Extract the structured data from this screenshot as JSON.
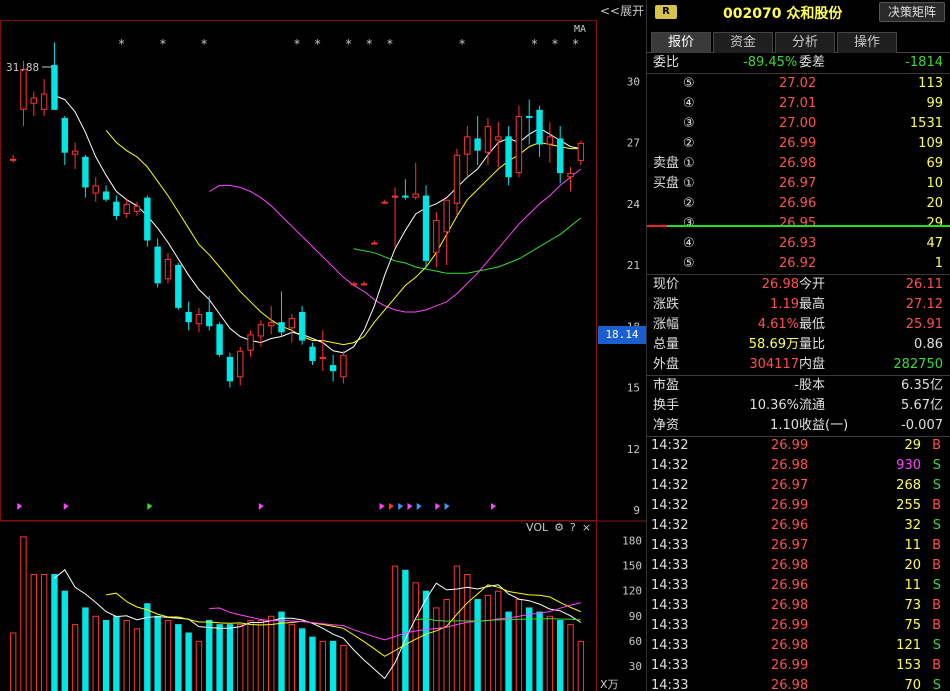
{
  "toolbar": {
    "collapse_label": "<<展开",
    "ma_label": "MA"
  },
  "main_chart": {
    "price_levels": [
      "30",
      "27",
      "24",
      "21",
      "18",
      "15",
      "12",
      "9"
    ],
    "price_level_values": [
      30,
      27,
      24,
      21,
      18,
      15,
      12,
      9
    ],
    "high_annotation": "31.88",
    "current_price_tag": "18.14",
    "star_markers_text": "*",
    "colors": {
      "up": "#ff3232",
      "down": "#00e5e5",
      "ma5": "#ffffff",
      "ma10": "#ffff00",
      "ma20": "#ff44ff",
      "ma60": "#33dd33",
      "price_tag_bg": "#1a5fd0"
    }
  },
  "volume_chart": {
    "label": "VOL",
    "gear_icon": "⚙",
    "help_icon": "?",
    "close_icon": "×",
    "levels": [
      "180",
      "150",
      "120",
      "90",
      "60",
      "30"
    ],
    "level_values": [
      180,
      150,
      120,
      90,
      60,
      30
    ],
    "unit": "X万"
  },
  "chart_data": {
    "type": "candlestick",
    "ylim": [
      9,
      33
    ],
    "volume_ylim": [
      0,
      195
    ],
    "candles": [
      {
        "o": 26.2,
        "h": 26.4,
        "l": 26.0,
        "c": 26.2,
        "v": 70
      },
      {
        "o": 28.6,
        "h": 31.0,
        "l": 27.8,
        "c": 30.6,
        "v": 185
      },
      {
        "o": 28.9,
        "h": 29.5,
        "l": 28.3,
        "c": 29.2,
        "v": 140
      },
      {
        "o": 28.6,
        "h": 30.1,
        "l": 28.3,
        "c": 29.4,
        "v": 140
      },
      {
        "o": 30.8,
        "h": 31.9,
        "l": 28.6,
        "c": 28.6,
        "v": 140
      },
      {
        "o": 28.2,
        "h": 28.3,
        "l": 25.9,
        "c": 26.5,
        "v": 120
      },
      {
        "o": 26.4,
        "h": 27.0,
        "l": 25.7,
        "c": 26.6,
        "v": 80
      },
      {
        "o": 26.3,
        "h": 26.4,
        "l": 24.3,
        "c": 24.8,
        "v": 100
      },
      {
        "o": 24.5,
        "h": 25.3,
        "l": 24.1,
        "c": 24.9,
        "v": 90
      },
      {
        "o": 24.6,
        "h": 24.9,
        "l": 24.1,
        "c": 24.2,
        "v": 85
      },
      {
        "o": 24.1,
        "h": 24.4,
        "l": 23.2,
        "c": 23.4,
        "v": 90
      },
      {
        "o": 23.5,
        "h": 24.2,
        "l": 23.3,
        "c": 24.0,
        "v": 85
      },
      {
        "o": 23.6,
        "h": 24.1,
        "l": 23.4,
        "c": 23.9,
        "v": 75
      },
      {
        "o": 24.3,
        "h": 24.4,
        "l": 21.9,
        "c": 22.2,
        "v": 105
      },
      {
        "o": 21.9,
        "h": 22.3,
        "l": 19.9,
        "c": 20.1,
        "v": 90
      },
      {
        "o": 20.3,
        "h": 21.6,
        "l": 20.1,
        "c": 21.3,
        "v": 85
      },
      {
        "o": 21.0,
        "h": 21.1,
        "l": 18.8,
        "c": 18.9,
        "v": 80
      },
      {
        "o": 18.7,
        "h": 19.2,
        "l": 17.8,
        "c": 18.2,
        "v": 70
      },
      {
        "o": 18.1,
        "h": 18.9,
        "l": 17.7,
        "c": 18.6,
        "v": 60
      },
      {
        "o": 18.7,
        "h": 19.5,
        "l": 17.8,
        "c": 18.0,
        "v": 85
      },
      {
        "o": 18.1,
        "h": 18.2,
        "l": 16.5,
        "c": 16.6,
        "v": 80
      },
      {
        "o": 16.5,
        "h": 16.7,
        "l": 15.0,
        "c": 15.3,
        "v": 80
      },
      {
        "o": 15.5,
        "h": 17.0,
        "l": 15.1,
        "c": 16.8,
        "v": 80
      },
      {
        "o": 16.8,
        "h": 17.8,
        "l": 16.5,
        "c": 17.6,
        "v": 85
      },
      {
        "o": 17.5,
        "h": 18.3,
        "l": 17.0,
        "c": 18.1,
        "v": 85
      },
      {
        "o": 18.0,
        "h": 19.0,
        "l": 17.6,
        "c": 18.2,
        "v": 90
      },
      {
        "o": 18.2,
        "h": 19.7,
        "l": 17.5,
        "c": 17.7,
        "v": 95
      },
      {
        "o": 17.9,
        "h": 18.6,
        "l": 17.2,
        "c": 18.4,
        "v": 80
      },
      {
        "o": 18.7,
        "h": 19.0,
        "l": 17.1,
        "c": 17.3,
        "v": 75
      },
      {
        "o": 17.0,
        "h": 17.2,
        "l": 16.1,
        "c": 16.3,
        "v": 65
      },
      {
        "o": 16.4,
        "h": 17.8,
        "l": 15.8,
        "c": 16.5,
        "v": 60
      },
      {
        "o": 16.1,
        "h": 16.6,
        "l": 15.3,
        "c": 15.8,
        "v": 60
      },
      {
        "o": 15.5,
        "h": 16.8,
        "l": 15.2,
        "c": 16.6,
        "v": 55
      },
      {
        "o": 20.1,
        "h": 20.2,
        "l": 20.0,
        "c": 20.1,
        "v": 5
      },
      {
        "o": 20.1,
        "h": 20.2,
        "l": 20.0,
        "c": 20.1,
        "v": 5
      },
      {
        "o": 22.1,
        "h": 22.2,
        "l": 22.0,
        "c": 22.1,
        "v": 5
      },
      {
        "o": 24.1,
        "h": 24.2,
        "l": 24.0,
        "c": 24.1,
        "v": 5
      },
      {
        "o": 24.3,
        "h": 24.8,
        "l": 21.9,
        "c": 24.4,
        "v": 150
      },
      {
        "o": 24.4,
        "h": 25.2,
        "l": 24.2,
        "c": 24.3,
        "v": 145
      },
      {
        "o": 24.3,
        "h": 26.0,
        "l": 24.2,
        "c": 24.5,
        "v": 130
      },
      {
        "o": 24.4,
        "h": 24.9,
        "l": 20.9,
        "c": 21.2,
        "v": 120
      },
      {
        "o": 21.6,
        "h": 23.6,
        "l": 20.9,
        "c": 23.2,
        "v": 100
      },
      {
        "o": 22.6,
        "h": 23.5,
        "l": 21.0,
        "c": 24.2,
        "v": 110
      },
      {
        "o": 24.0,
        "h": 26.7,
        "l": 23.4,
        "c": 26.4,
        "v": 150
      },
      {
        "o": 26.4,
        "h": 27.8,
        "l": 25.3,
        "c": 27.3,
        "v": 140
      },
      {
        "o": 27.2,
        "h": 28.3,
        "l": 25.9,
        "c": 26.6,
        "v": 110
      },
      {
        "o": 26.5,
        "h": 28.2,
        "l": 25.9,
        "c": 27.8,
        "v": 115
      },
      {
        "o": 27.1,
        "h": 28.0,
        "l": 25.8,
        "c": 27.3,
        "v": 120
      },
      {
        "o": 27.3,
        "h": 27.8,
        "l": 24.9,
        "c": 25.3,
        "v": 95
      },
      {
        "o": 25.5,
        "h": 28.8,
        "l": 25.3,
        "c": 28.3,
        "v": 110
      },
      {
        "o": 28.3,
        "h": 29.1,
        "l": 26.9,
        "c": 28.2,
        "v": 100
      },
      {
        "o": 28.6,
        "h": 28.8,
        "l": 26.3,
        "c": 26.9,
        "v": 95
      },
      {
        "o": 26.9,
        "h": 28.0,
        "l": 26.0,
        "c": 27.3,
        "v": 90
      },
      {
        "o": 27.2,
        "h": 27.8,
        "l": 25.0,
        "c": 25.5,
        "v": 85
      },
      {
        "o": 25.3,
        "h": 25.8,
        "l": 24.6,
        "c": 25.5,
        "v": 80
      },
      {
        "o": 26.1,
        "h": 27.1,
        "l": 25.9,
        "c": 26.98,
        "v": 60
      }
    ],
    "ma5": [
      null,
      null,
      null,
      null,
      29.3,
      29.1,
      28.5,
      27.5,
      26.3,
      25.4,
      24.6,
      24.2,
      23.9,
      23.4,
      22.8,
      22.1,
      21.3,
      20.5,
      19.8,
      19.3,
      18.6,
      17.9,
      17.5,
      17.3,
      17.2,
      17.4,
      17.5,
      17.7,
      17.6,
      17.4,
      17.2,
      16.8,
      16.7,
      17.0,
      17.8,
      19.0,
      20.5,
      21.8,
      22.7,
      23.5,
      23.8,
      24.0,
      24.3,
      24.8,
      25.3,
      25.7,
      26.4,
      27.0,
      27.2,
      27.0,
      27.4,
      27.7,
      27.4,
      27.1,
      26.8,
      26.7
    ],
    "ma10": [
      null,
      null,
      null,
      null,
      null,
      null,
      null,
      null,
      null,
      27.6,
      27.0,
      26.6,
      26.3,
      25.8,
      25.1,
      24.4,
      23.6,
      22.8,
      22.0,
      21.5,
      20.9,
      20.3,
      19.7,
      19.2,
      18.7,
      18.3,
      18.0,
      17.8,
      17.5,
      17.3,
      17.3,
      17.2,
      17.1,
      17.2,
      17.5,
      18.2,
      18.8,
      19.4,
      20.0,
      20.4,
      20.9,
      21.6,
      22.5,
      23.4,
      24.2,
      24.7,
      25.2,
      25.7,
      26.1,
      26.4,
      26.8,
      27.0,
      26.9,
      26.8,
      26.7,
      26.7
    ],
    "ma20": [
      null,
      null,
      null,
      null,
      null,
      null,
      null,
      null,
      null,
      null,
      null,
      null,
      null,
      null,
      null,
      null,
      null,
      null,
      null,
      24.6,
      24.9,
      24.9,
      24.8,
      24.6,
      24.3,
      23.9,
      23.4,
      22.9,
      22.4,
      21.9,
      21.4,
      20.9,
      20.4,
      20.0,
      19.7,
      19.3,
      19.0,
      18.8,
      18.7,
      18.7,
      18.8,
      19.0,
      19.2,
      19.6,
      20.1,
      20.6,
      21.2,
      21.8,
      22.4,
      23.0,
      23.5,
      24.0,
      24.4,
      24.9,
      25.3,
      25.7
    ],
    "ma60": [
      null,
      null,
      null,
      null,
      null,
      null,
      null,
      null,
      null,
      null,
      null,
      null,
      null,
      null,
      null,
      null,
      null,
      null,
      null,
      null,
      null,
      null,
      null,
      null,
      null,
      null,
      null,
      null,
      null,
      null,
      null,
      null,
      null,
      21.8,
      21.7,
      21.6,
      21.4,
      21.2,
      21.1,
      20.9,
      20.8,
      20.7,
      20.6,
      20.6,
      20.6,
      20.7,
      20.8,
      20.9,
      21.1,
      21.3,
      21.6,
      21.9,
      22.2,
      22.5,
      22.9,
      23.3
    ]
  },
  "panel": {
    "badge": "R",
    "stock_title": "002070 众和股份",
    "matrix_button": "决策矩阵",
    "tabs": [
      "报价",
      "资金",
      "分析",
      "操作"
    ],
    "commission": {
      "ratio_label": "委比",
      "ratio_value": "-89.45%",
      "diff_label": "委差",
      "diff_value": "-1814"
    },
    "sell_label": "卖盘",
    "buy_label": "买盘",
    "sells": [
      {
        "level": "⑤",
        "price": "27.02",
        "vol": "113"
      },
      {
        "level": "④",
        "price": "27.01",
        "vol": "99"
      },
      {
        "level": "③",
        "price": "27.00",
        "vol": "1531"
      },
      {
        "level": "②",
        "price": "26.99",
        "vol": "109"
      },
      {
        "level": "①",
        "price": "26.98",
        "vol": "69"
      }
    ],
    "buys": [
      {
        "level": "①",
        "price": "26.97",
        "vol": "10"
      },
      {
        "level": "②",
        "price": "26.96",
        "vol": "20"
      },
      {
        "level": "③",
        "price": "26.95",
        "vol": "29"
      },
      {
        "level": "④",
        "price": "26.93",
        "vol": "47"
      },
      {
        "level": "⑤",
        "price": "26.92",
        "vol": "1"
      }
    ],
    "stats": [
      {
        "l1": "现价",
        "v1": "26.98",
        "l2": "今开",
        "v2": "26.11",
        "c1": "red",
        "c2": "red"
      },
      {
        "l1": "涨跌",
        "v1": "1.19",
        "l2": "最高",
        "v2": "27.12",
        "c1": "red",
        "c2": "red"
      },
      {
        "l1": "涨幅",
        "v1": "4.61%",
        "l2": "最低",
        "v2": "25.91",
        "c1": "red",
        "c2": "red"
      },
      {
        "l1": "总量",
        "v1": "58.69万",
        "l2": "量比",
        "v2": "0.86",
        "c1": "yellow",
        "c2": "white"
      },
      {
        "l1": "外盘",
        "v1": "304117",
        "l2": "内盘",
        "v2": "282750",
        "c1": "red",
        "c2": "green"
      }
    ],
    "stats2": [
      {
        "l1": "市盈",
        "v1": "-",
        "l2": "股本",
        "v2": "6.35亿"
      },
      {
        "l1": "换手",
        "v1": "10.36%",
        "l2": "流通",
        "v2": "5.67亿"
      },
      {
        "l1": "净资",
        "v1": "1.10",
        "l2": "收益(一)",
        "v2": "-0.007"
      }
    ],
    "ticks": [
      {
        "time": "14:32",
        "price": "26.99",
        "vol": "29",
        "side": "B",
        "vcolor": "yellow"
      },
      {
        "time": "14:32",
        "price": "26.98",
        "vol": "930",
        "side": "S",
        "vcolor": "magenta"
      },
      {
        "time": "14:32",
        "price": "26.97",
        "vol": "268",
        "side": "S",
        "vcolor": "yellow"
      },
      {
        "time": "14:32",
        "price": "26.99",
        "vol": "255",
        "side": "B",
        "vcolor": "yellow"
      },
      {
        "time": "14:32",
        "price": "26.96",
        "vol": "32",
        "side": "S",
        "vcolor": "yellow"
      },
      {
        "time": "14:33",
        "price": "26.97",
        "vol": "11",
        "side": "B",
        "vcolor": "yellow"
      },
      {
        "time": "14:33",
        "price": "26.98",
        "vol": "20",
        "side": "B",
        "vcolor": "yellow"
      },
      {
        "time": "14:33",
        "price": "26.96",
        "vol": "11",
        "side": "S",
        "vcolor": "yellow"
      },
      {
        "time": "14:33",
        "price": "26.98",
        "vol": "73",
        "side": "B",
        "vcolor": "yellow"
      },
      {
        "time": "14:33",
        "price": "26.99",
        "vol": "75",
        "side": "B",
        "vcolor": "yellow"
      },
      {
        "time": "14:33",
        "price": "26.98",
        "vol": "121",
        "side": "S",
        "vcolor": "yellow"
      },
      {
        "time": "14:33",
        "price": "26.99",
        "vol": "153",
        "side": "B",
        "vcolor": "yellow"
      },
      {
        "time": "14:33",
        "price": "26.98",
        "vol": "70",
        "side": "S",
        "vcolor": "yellow"
      }
    ]
  }
}
